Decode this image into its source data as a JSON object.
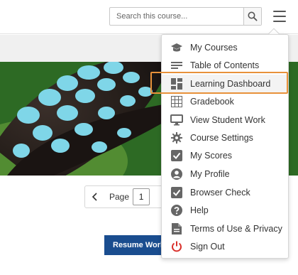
{
  "header": {
    "search_placeholder": "Search this course...",
    "search_icon": "magnifier-icon",
    "menu_icon": "hamburger-icon"
  },
  "pager": {
    "label": "Page",
    "value": "1"
  },
  "resume_button": "Resume Work",
  "menu": {
    "items": [
      {
        "label": "My Courses",
        "icon": "graduation-cap-icon"
      },
      {
        "label": "Table of Contents",
        "icon": "list-icon"
      },
      {
        "label": "Learning Dashboard",
        "icon": "dashboard-icon",
        "highlighted": true
      },
      {
        "label": "Gradebook",
        "icon": "grid-icon"
      },
      {
        "label": "View Student Work",
        "icon": "monitor-icon"
      },
      {
        "label": "Course Settings",
        "icon": "gear-icon"
      },
      {
        "label": "My Scores",
        "icon": "checkbox-icon"
      },
      {
        "label": "My Profile",
        "icon": "person-icon"
      },
      {
        "label": "Browser Check",
        "icon": "checkbox-icon"
      },
      {
        "label": "Help",
        "icon": "question-icon"
      },
      {
        "label": "Terms of Use & Privacy",
        "icon": "document-icon"
      },
      {
        "label": "Sign Out",
        "icon": "power-icon"
      }
    ]
  },
  "colors": {
    "highlight_border": "#e8913a",
    "signout_icon": "#d9302b",
    "resume_button_bg": "#1a4d8f",
    "icon_gray": "#666666"
  }
}
